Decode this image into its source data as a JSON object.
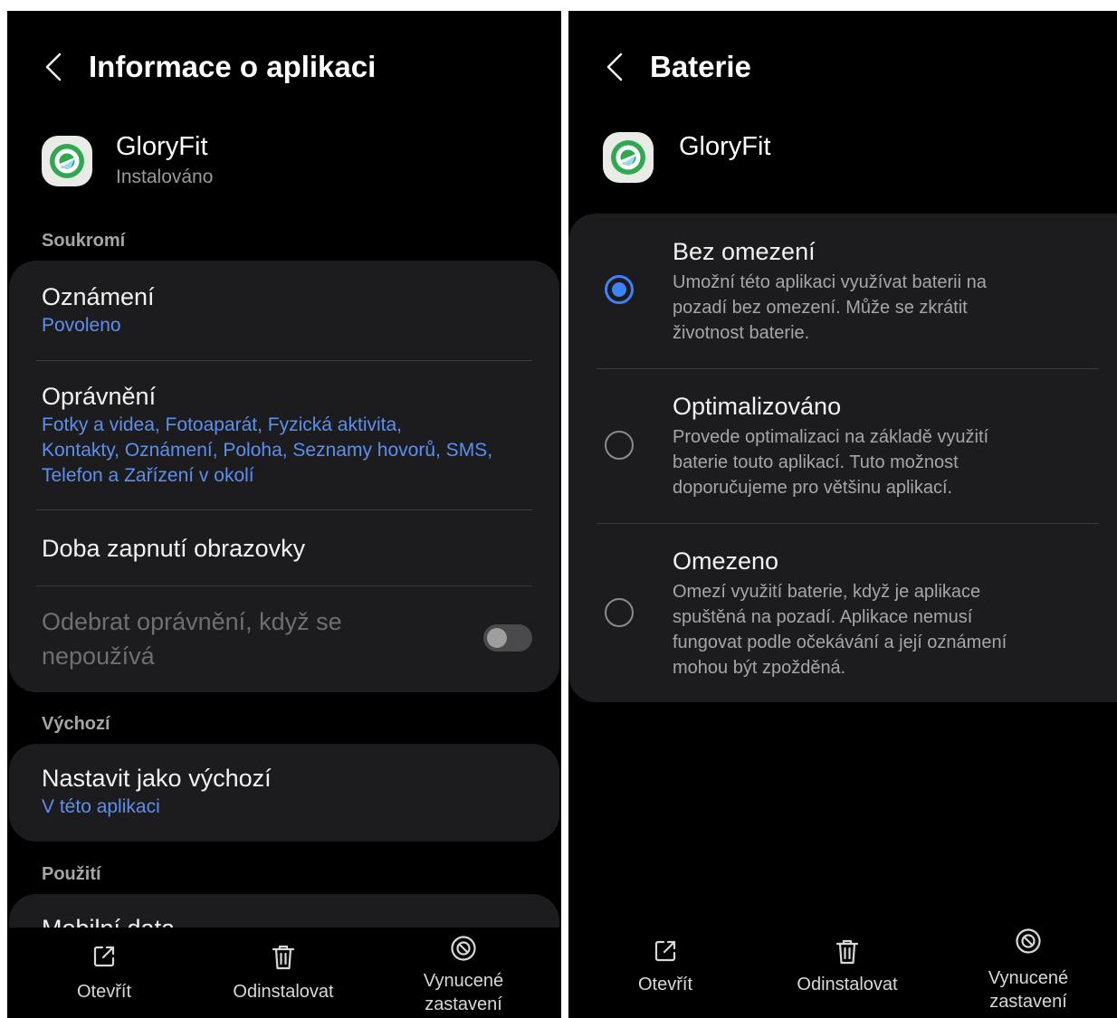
{
  "left": {
    "title": "Informace o aplikaci",
    "app": {
      "name": "GloryFit",
      "status": "Instalováno"
    },
    "sections": {
      "privacy": "Soukromí",
      "defaults": "Výchozí",
      "usage": "Použití"
    },
    "notifications": {
      "title": "Oznámení",
      "value": "Povoleno"
    },
    "permissions": {
      "title": "Oprávnění",
      "value_line1": "Fotky a videa, Fotoaparát, Fyzická aktivita,",
      "value_line2": "Kontakty, Oznámení, Poloha, Seznamy hovorů, SMS,",
      "value_line3": "Telefon a Zařízení v okolí"
    },
    "screen_time": {
      "title": "Doba zapnutí obrazovky"
    },
    "remove_permissions": {
      "line1": "Odebrat oprávnění, když se",
      "line2": "nepoužívá",
      "enabled": false
    },
    "set_default": {
      "title": "Nastavit jako výchozí",
      "value": "V této aplikaci"
    },
    "mobile_data": {
      "title": "Mobilní data"
    }
  },
  "right": {
    "title": "Baterie",
    "app": {
      "name": "GloryFit"
    },
    "options": [
      {
        "title": "Bez omezení",
        "line1": "Umožní této aplikaci využívat baterii na",
        "line2": "pozadí bez omezení. Může se zkrátit",
        "line3": "životnost baterie.",
        "selected": true
      },
      {
        "title": "Optimalizováno",
        "line1": "Provede optimalizaci na základě využití",
        "line2": "baterie touto aplikací. Tuto možnost",
        "line3": "doporučujeme pro většinu aplikací.",
        "selected": false
      },
      {
        "title": "Omezeno",
        "line1": "Omezí využití baterie, když je aplikace",
        "line2": "spuštěná na pozadí. Aplikace nemusí",
        "line3": "fungovat podle očekávání a její oznámení",
        "line4": "mohou být zpožděná.",
        "selected": false
      }
    ]
  },
  "bottom_bar": {
    "open": "Otevřít",
    "uninstall": "Odinstalovat",
    "force_stop_line1": "Vynucené",
    "force_stop_line2": "zastavení"
  },
  "colors": {
    "background": "#000000",
    "card": "#1c1c1e",
    "accent_blue": "#5b8ff0",
    "radio_blue": "#3e82f7",
    "app_icon_green": "#2fa84f"
  },
  "icons": [
    "back-arrow-icon",
    "app-icon",
    "open-external-icon",
    "trash-icon",
    "force-stop-icon"
  ]
}
